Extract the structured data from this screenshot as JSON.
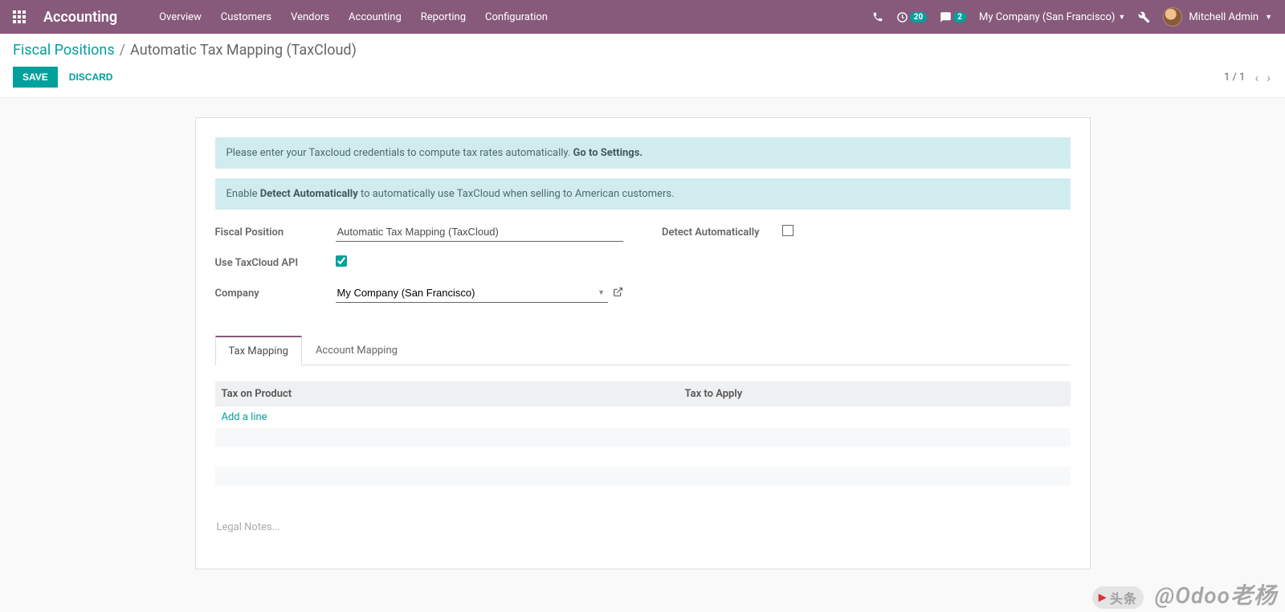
{
  "navbar": {
    "brand": "Accounting",
    "menu": [
      "Overview",
      "Customers",
      "Vendors",
      "Accounting",
      "Reporting",
      "Configuration"
    ],
    "activities_badge": "20",
    "messages_badge": "2",
    "company": "My Company (San Francisco)",
    "user": "Mitchell Admin"
  },
  "breadcrumb": {
    "parent": "Fiscal Positions",
    "active": "Automatic Tax Mapping (TaxCloud)"
  },
  "cp": {
    "save": "SAVE",
    "discard": "DISCARD",
    "pager": "1 / 1"
  },
  "alerts": {
    "a1_pre": "Please enter your Taxcloud credentials to compute tax rates automatically. ",
    "a1_bold": "Go to Settings.",
    "a2_pre": "Enable ",
    "a2_bold": "Detect Automatically",
    "a2_post": " to automatically use TaxCloud when selling to American customers."
  },
  "form": {
    "labels": {
      "fp": "Fiscal Position",
      "api": "Use TaxCloud API",
      "company": "Company",
      "detect": "Detect Automatically"
    },
    "values": {
      "fp": "Automatic Tax Mapping (TaxCloud)",
      "company": "My Company (San Francisco)",
      "api_checked": true,
      "detect_checked": false
    }
  },
  "tabs": {
    "a": "Tax Mapping",
    "b": "Account Mapping"
  },
  "table": {
    "col1": "Tax on Product",
    "col2": "Tax to Apply",
    "addline": "Add a line"
  },
  "legal_placeholder": "Legal Notes...",
  "watermark": {
    "tag": "头条",
    "text": "@Odoo老杨"
  }
}
